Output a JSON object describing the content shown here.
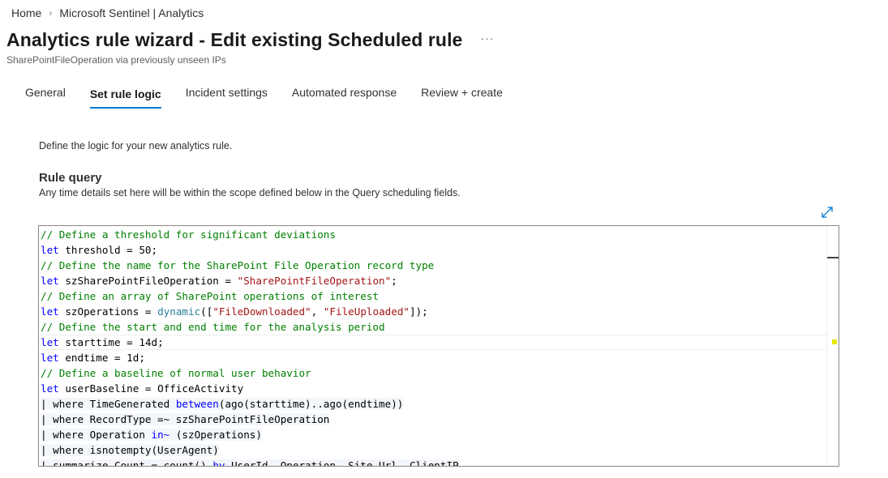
{
  "breadcrumb": {
    "home": "Home",
    "separator": "›",
    "current": "Microsoft Sentinel | Analytics"
  },
  "header": {
    "title": "Analytics rule wizard - Edit existing Scheduled rule",
    "more": "···",
    "subtitle": "SharePointFileOperation via previously unseen IPs"
  },
  "tabs": [
    {
      "label": "General",
      "active": false
    },
    {
      "label": "Set rule logic",
      "active": true
    },
    {
      "label": "Incident settings",
      "active": false
    },
    {
      "label": "Automated response",
      "active": false
    },
    {
      "label": "Review + create",
      "active": false
    }
  ],
  "content": {
    "description": "Define the logic for your new analytics rule.",
    "rule_query_title": "Rule query",
    "rule_query_desc": "Any time details set here will be within the scope defined below in the Query scheduling fields."
  },
  "icons": {
    "expand": "expand-icon"
  },
  "colors": {
    "accent": "#0078d4",
    "comment": "#008000",
    "keyword": "#0000ff",
    "function": "#267f99",
    "string": "#a31515"
  },
  "code": {
    "lines": [
      [
        {
          "t": "// Define a threshold for significant deviations",
          "c": "cm"
        }
      ],
      [
        {
          "t": "let",
          "c": "kw"
        },
        {
          "t": " threshold = 50;",
          "c": ""
        }
      ],
      [
        {
          "t": "// Define the name for the SharePoint File Operation record type",
          "c": "cm"
        }
      ],
      [
        {
          "t": "let",
          "c": "kw"
        },
        {
          "t": " szSharePointFileOperation = ",
          "c": ""
        },
        {
          "t": "\"SharePointFileOperation\"",
          "c": "str"
        },
        {
          "t": ";",
          "c": ""
        }
      ],
      [
        {
          "t": "// Define an array of SharePoint operations of interest",
          "c": "cm"
        }
      ],
      [
        {
          "t": "let",
          "c": "kw"
        },
        {
          "t": " szOperations = ",
          "c": ""
        },
        {
          "t": "dynamic",
          "c": "fn"
        },
        {
          "t": "([",
          "c": ""
        },
        {
          "t": "\"FileDownloaded\"",
          "c": "str"
        },
        {
          "t": ", ",
          "c": ""
        },
        {
          "t": "\"FileUploaded\"",
          "c": "str"
        },
        {
          "t": "]);",
          "c": ""
        }
      ],
      [
        {
          "t": "// Define the start and end time for the analysis period",
          "c": "cm"
        }
      ],
      [
        {
          "t": "let",
          "c": "kw"
        },
        {
          "t": " starttime = 14d;",
          "c": ""
        }
      ],
      [
        {
          "t": "let",
          "c": "kw"
        },
        {
          "t": " endtime = 1d;",
          "c": ""
        }
      ],
      [
        {
          "t": "// Define a baseline of normal user behavior",
          "c": "cm"
        }
      ],
      [
        {
          "t": "let",
          "c": "kw"
        },
        {
          "t": " userBaseline = OfficeActivity",
          "c": ""
        }
      ],
      [
        {
          "t": "| where TimeGenerated ",
          "c": "hl"
        },
        {
          "t": "between",
          "c": "kw hl"
        },
        {
          "t": "(ago(starttime)..ago(endtime))",
          "c": "hl"
        }
      ],
      [
        {
          "t": "| where RecordType =~ szSharePointFileOperation",
          "c": "hl"
        }
      ],
      [
        {
          "t": "| where Operation ",
          "c": "hl"
        },
        {
          "t": "in~",
          "c": "kw hl"
        },
        {
          "t": " (szOperations)",
          "c": "hl"
        }
      ],
      [
        {
          "t": "| where isnotempty(UserAgent)",
          "c": "hl"
        }
      ],
      [
        {
          "t": "| summarize Count = count() ",
          "c": "hl"
        },
        {
          "t": "by",
          "c": "kw hl"
        },
        {
          "t": " UserId, Operation, Site_Url, ClientIP",
          "c": "hl"
        }
      ]
    ],
    "current_line_index": 7
  }
}
